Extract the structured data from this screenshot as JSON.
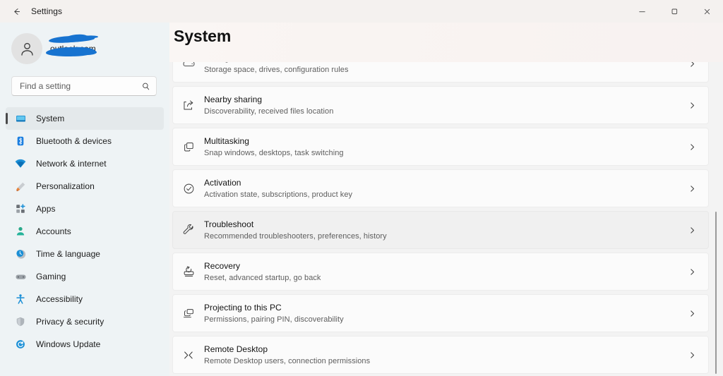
{
  "titlebar": {
    "back_icon": "back-arrow-icon",
    "title": "Settings",
    "minimize_label": "Minimize",
    "maximize_label": "Restore",
    "close_label": "Close"
  },
  "account": {
    "avatar_icon": "person-avatar-icon",
    "name": "",
    "email_visible": "outlook.com",
    "redacted": "true"
  },
  "search": {
    "placeholder": "Find a setting",
    "value": "",
    "icon": "search-icon"
  },
  "sidebar": {
    "items": [
      {
        "label": "System",
        "icon": "monitor-icon",
        "selected": true
      },
      {
        "label": "Bluetooth & devices",
        "icon": "bluetooth-icon",
        "selected": false
      },
      {
        "label": "Network & internet",
        "icon": "wifi-icon",
        "selected": false
      },
      {
        "label": "Personalization",
        "icon": "paintbrush-icon",
        "selected": false
      },
      {
        "label": "Apps",
        "icon": "apps-grid-icon",
        "selected": false
      },
      {
        "label": "Accounts",
        "icon": "account-person-icon",
        "selected": false
      },
      {
        "label": "Time & language",
        "icon": "clock-globe-icon",
        "selected": false
      },
      {
        "label": "Gaming",
        "icon": "gamepad-icon",
        "selected": false
      },
      {
        "label": "Accessibility",
        "icon": "accessibility-person-icon",
        "selected": false
      },
      {
        "label": "Privacy & security",
        "icon": "shield-icon",
        "selected": false
      },
      {
        "label": "Windows Update",
        "icon": "update-refresh-icon",
        "selected": false
      }
    ]
  },
  "main": {
    "page_title": "System",
    "chevron_icon": "chevron-right-icon",
    "rows": [
      {
        "title": "Storage",
        "subtitle": "Storage space, drives, configuration rules",
        "icon": "storage-drive-icon",
        "hover": false,
        "clipped": true
      },
      {
        "title": "Nearby sharing",
        "subtitle": "Discoverability, received files location",
        "icon": "share-icon",
        "hover": false
      },
      {
        "title": "Multitasking",
        "subtitle": "Snap windows, desktops, task switching",
        "icon": "multitasking-windows-icon",
        "hover": false
      },
      {
        "title": "Activation",
        "subtitle": "Activation state, subscriptions, product key",
        "icon": "check-circle-icon",
        "hover": false
      },
      {
        "title": "Troubleshoot",
        "subtitle": "Recommended troubleshooters, preferences, history",
        "icon": "wrench-icon",
        "hover": true
      },
      {
        "title": "Recovery",
        "subtitle": "Reset, advanced startup, go back",
        "icon": "recovery-reset-icon",
        "hover": false
      },
      {
        "title": "Projecting to this PC",
        "subtitle": "Permissions, pairing PIN, discoverability",
        "icon": "projecting-screens-icon",
        "hover": false
      },
      {
        "title": "Remote Desktop",
        "subtitle": "Remote Desktop users, connection permissions",
        "icon": "remote-desktop-icon",
        "hover": false
      }
    ]
  },
  "scrollbar": {
    "name": "vertical-scrollbar"
  },
  "colors": {
    "sidebar_bg": "#eef3f5",
    "content_bg": "#f3f3f3",
    "card_bg": "#fbfbfb",
    "card_hover_bg": "#f0f0f0",
    "mica_header": "#f9f4f2",
    "accent_blue": "#0078d4",
    "redaction_blue": "#1773d0"
  }
}
